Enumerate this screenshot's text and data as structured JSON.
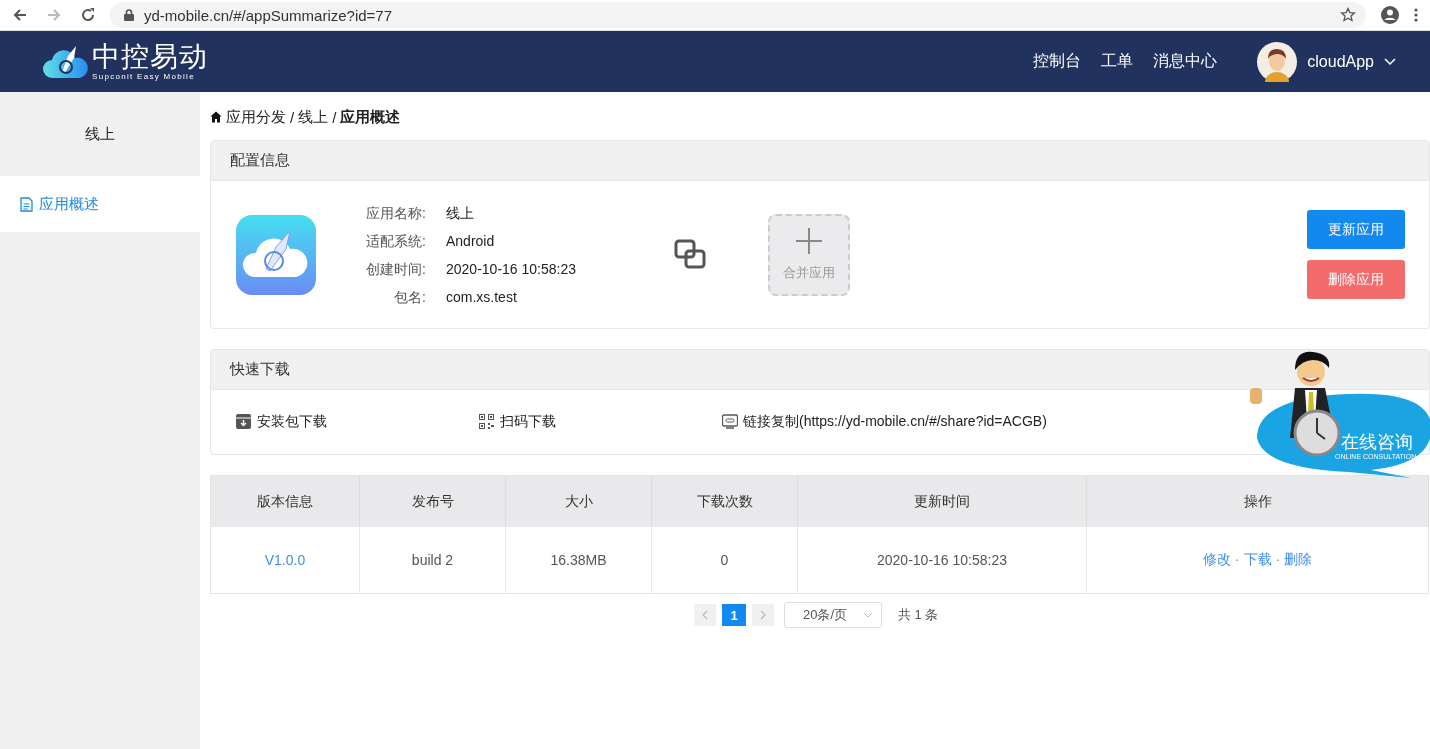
{
  "browser": {
    "url": "yd-mobile.cn/#/appSummarize?id=77"
  },
  "header": {
    "logo": {
      "title": "中控易动",
      "subtitle": "Supconit Easy Mobile"
    },
    "nav": [
      "控制台",
      "工单",
      "消息中心"
    ],
    "user": {
      "name": "cloudApp"
    }
  },
  "sidebar": {
    "items": [
      {
        "label": "线上",
        "kind": "heading",
        "selected": false
      },
      {
        "label": "应用概述",
        "kind": "link",
        "selected": true
      }
    ]
  },
  "breadcrumb": {
    "separator": "/",
    "items": [
      {
        "label": "应用分发",
        "current": false
      },
      {
        "label": "线上",
        "current": false
      },
      {
        "label": "应用概述",
        "current": true
      }
    ]
  },
  "config": {
    "title": "配置信息",
    "fields": [
      {
        "label": "应用名称:",
        "value": "线上"
      },
      {
        "label": "适配系统:",
        "value": "Android"
      },
      {
        "label": "创建时间:",
        "value": "2020-10-16 10:58:23"
      },
      {
        "label": "包名:",
        "value": "com.xs.test"
      }
    ],
    "merge": {
      "label": "合并应用"
    },
    "buttons": [
      {
        "label": "更新应用",
        "kind": "primary"
      },
      {
        "label": "删除应用",
        "kind": "danger"
      }
    ]
  },
  "download": {
    "title": "快速下载",
    "items": [
      {
        "label": "安装包下载",
        "kind": "package"
      },
      {
        "label": "扫码下载",
        "kind": "qr"
      },
      {
        "label": "链接复制(https://yd-mobile.cn/#/share?id=ACGB)",
        "kind": "link"
      }
    ]
  },
  "table": {
    "columns": [
      "版本信息",
      "发布号",
      "大小",
      "下载次数",
      "更新时间",
      "操作"
    ],
    "rows": [
      {
        "version": "V1.0.0",
        "build": "build 2",
        "size": "16.38MB",
        "downloads": "0",
        "updated": "2020-10-16 10:58:23",
        "actions": [
          "修改",
          "下载",
          "删除"
        ],
        "action_separator": "·"
      }
    ]
  },
  "pagination": {
    "pages": [
      {
        "label": "1",
        "selected": true
      }
    ],
    "page_size": "20条/页",
    "total": "共 1 条"
  },
  "consult": {
    "title": "在线咨询",
    "subtitle": "ONLINE CONSULTATION"
  }
}
